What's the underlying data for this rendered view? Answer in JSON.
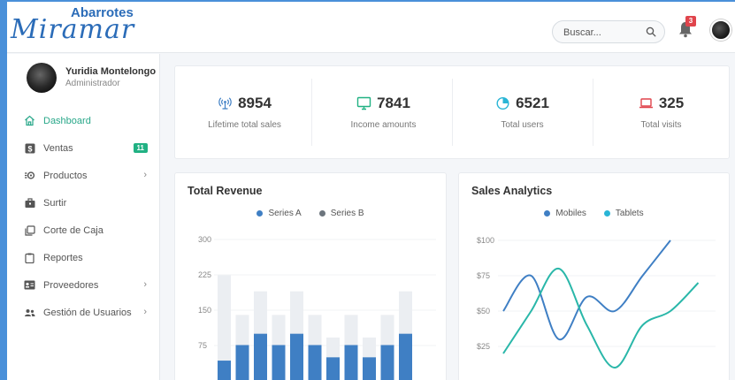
{
  "brand": {
    "top": "Abarrotes",
    "main": "Miramar"
  },
  "search": {
    "placeholder": "Buscar..."
  },
  "notifications": {
    "count": "3"
  },
  "user": {
    "name": "Yuridia Montelongo",
    "role": "Administrador"
  },
  "sidebar": {
    "items": [
      {
        "label": "Dashboard",
        "icon": "home-icon",
        "active": true
      },
      {
        "label": "Ventas",
        "icon": "dollar-icon",
        "badge": "11"
      },
      {
        "label": "Productos",
        "icon": "products-icon",
        "chevron": true
      },
      {
        "label": "Surtir",
        "icon": "briefcase-icon"
      },
      {
        "label": "Corte de Caja",
        "icon": "copy-icon"
      },
      {
        "label": "Reportes",
        "icon": "clipboard-icon"
      },
      {
        "label": "Proveedores",
        "icon": "id-card-icon",
        "chevron": true
      },
      {
        "label": "Gestión de Usuarios",
        "icon": "users-icon",
        "chevron": true
      }
    ]
  },
  "stats": [
    {
      "value": "8954",
      "label": "Lifetime total sales",
      "icon": "broadcast-icon",
      "color": "#3f7fc4"
    },
    {
      "value": "7841",
      "label": "Income amounts",
      "icon": "monitor-icon",
      "color": "#21b183"
    },
    {
      "value": "6521",
      "label": "Total users",
      "icon": "pie-icon",
      "color": "#29b5d6"
    },
    {
      "value": "325",
      "label": "Total visits",
      "icon": "laptop-icon",
      "color": "#e0444c"
    }
  ],
  "colors": {
    "primary": "#3f7fc4",
    "bar_bg": "#ebeef2",
    "series_b": "#6c757d",
    "teal": "#2ab7a9",
    "tablets": "#29b5d6"
  },
  "chart_data": [
    {
      "type": "bar",
      "title": "Total Revenue",
      "legend_position": "top",
      "series": [
        {
          "name": "Series A",
          "values": [
            43,
            76,
            100,
            76,
            100,
            76,
            50,
            76,
            50,
            76,
            100
          ]
        },
        {
          "name": "Series B",
          "values": [
            224,
            140,
            190,
            140,
            190,
            140,
            92,
            140,
            92,
            140,
            190
          ]
        }
      ],
      "yticks": [
        "300",
        "225",
        "150",
        "75"
      ],
      "ylim": [
        0,
        300
      ],
      "visible_y_min": 0
    },
    {
      "type": "line",
      "title": "Sales Analytics",
      "legend_position": "top",
      "series": [
        {
          "name": "Mobiles",
          "points": [
            [
              0,
              50
            ],
            [
              1,
              75
            ],
            [
              2,
              30
            ],
            [
              3,
              60
            ],
            [
              4,
              50
            ],
            [
              5,
              75
            ],
            [
              6,
              100
            ]
          ]
        },
        {
          "name": "Tablets",
          "points": [
            [
              0,
              20
            ],
            [
              1,
              50
            ],
            [
              2,
              80
            ],
            [
              3,
              40
            ],
            [
              4,
              10
            ],
            [
              5,
              40
            ],
            [
              6,
              50
            ],
            [
              7,
              70
            ]
          ]
        }
      ],
      "yticks": [
        "$100",
        "$75",
        "$50",
        "$25"
      ],
      "ylim": [
        0,
        100
      ]
    }
  ]
}
